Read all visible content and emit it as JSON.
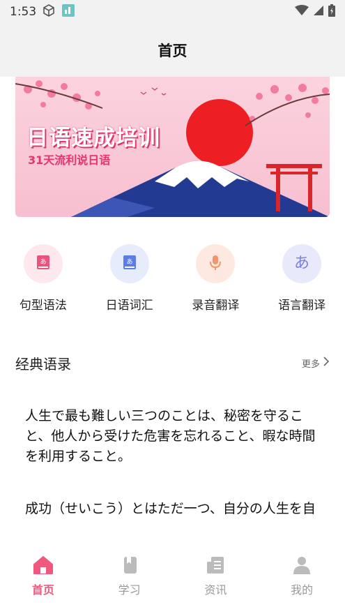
{
  "status_bar": {
    "time": "1:53"
  },
  "header": {
    "title": "首页"
  },
  "banner": {
    "title": "日语速成培训",
    "subtitle": "31天流利说日语"
  },
  "quick_actions": [
    {
      "label": "句型语法",
      "icon": "grammar-book-icon",
      "color": "#e8547c",
      "bg": "#fde8ee"
    },
    {
      "label": "日语词汇",
      "icon": "vocabulary-book-icon",
      "color": "#5a7de6",
      "bg": "#e6ecfc"
    },
    {
      "label": "录音翻译",
      "icon": "microphone-icon",
      "color": "#f3946c",
      "bg": "#fde9df"
    },
    {
      "label": "语言翻译",
      "icon": "hiragana-a-icon",
      "color": "#7a80e0",
      "bg": "#e8e9fb"
    }
  ],
  "section": {
    "title": "经典语录",
    "more": "更多"
  },
  "quotes": [
    "人生で最も難しい三つのことは、秘密を守ること、他人から受けた危害を忘れること、暇な時間を利用すること。",
    "成功（せいこう）とはただ一つ、自分の人生を自分の流儀（りゅうぎ）で過（す）ごすこと。"
  ],
  "tabs": [
    {
      "label": "首页",
      "icon": "home-icon",
      "active": true
    },
    {
      "label": "学习",
      "icon": "book-icon",
      "active": false
    },
    {
      "label": "资讯",
      "icon": "news-icon",
      "active": false
    },
    {
      "label": "我的",
      "icon": "user-icon",
      "active": false
    }
  ],
  "colors": {
    "accent": "#f0587f",
    "inactive": "#bbbbbb",
    "header_bg": "#f2f2f2"
  }
}
